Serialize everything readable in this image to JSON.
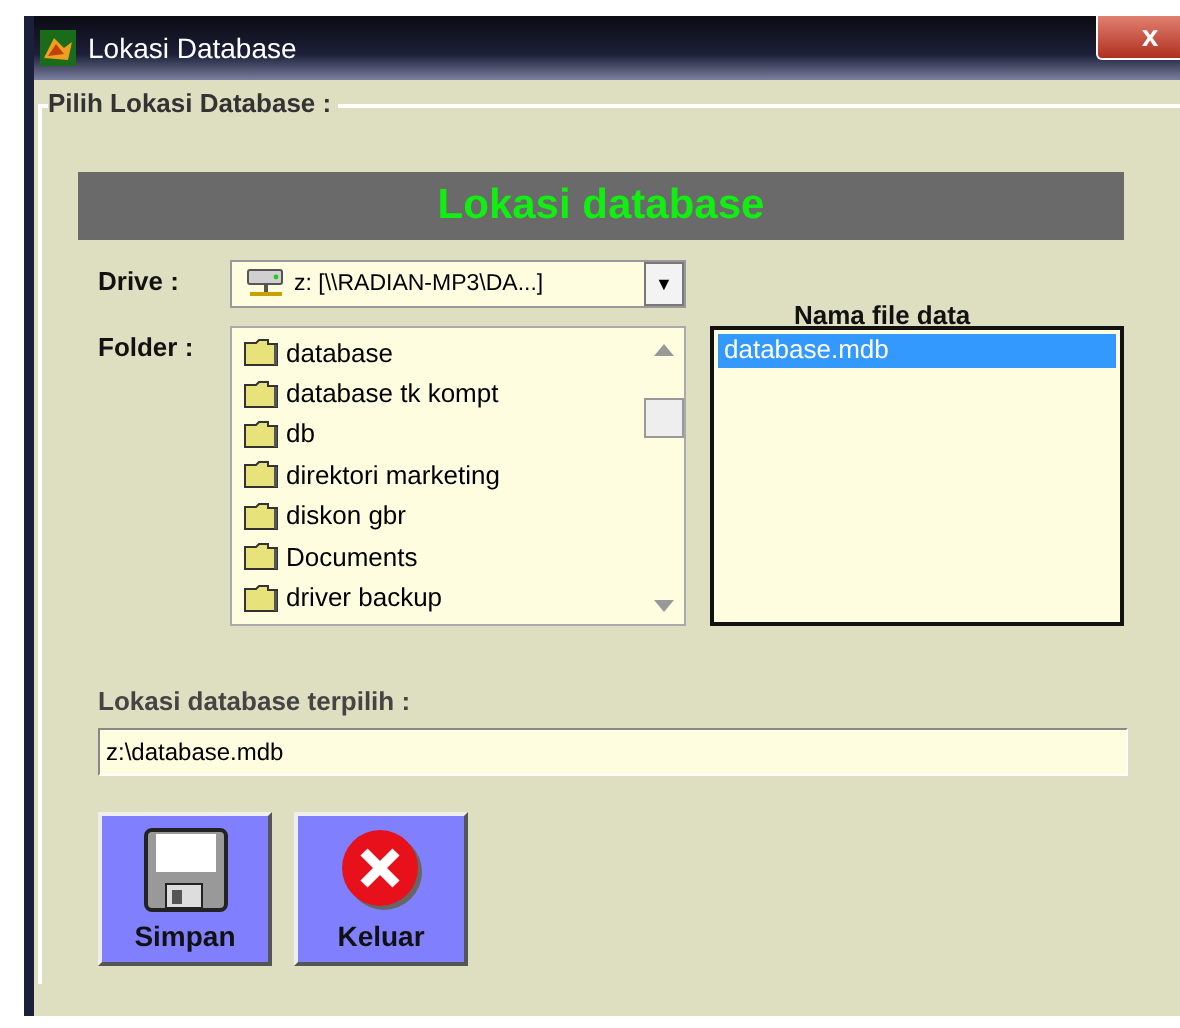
{
  "window": {
    "title": "Lokasi Database",
    "close": "x"
  },
  "group": {
    "title": "Pilih Lokasi Database :"
  },
  "banner": "Lokasi database",
  "drive": {
    "label": "Drive :",
    "value": "z: [\\\\RADIAN-MP3\\DA...]",
    "arrow": "▼"
  },
  "folder": {
    "label": "Folder :",
    "items": [
      {
        "name": "database"
      },
      {
        "name": "database tk kompt"
      },
      {
        "name": "db"
      },
      {
        "name": "direktori marketing"
      },
      {
        "name": "diskon gbr"
      },
      {
        "name": "Documents"
      },
      {
        "name": "driver backup"
      }
    ]
  },
  "files": {
    "label": "Nama file data",
    "items": [
      {
        "name": "database.mdb",
        "selected": true
      }
    ]
  },
  "selected_path": {
    "label": "Lokasi database terpilih :",
    "value": "z:\\database.mdb"
  },
  "buttons": [
    {
      "kind": "save",
      "label": "Simpan"
    },
    {
      "kind": "exit",
      "label": "Keluar"
    }
  ]
}
